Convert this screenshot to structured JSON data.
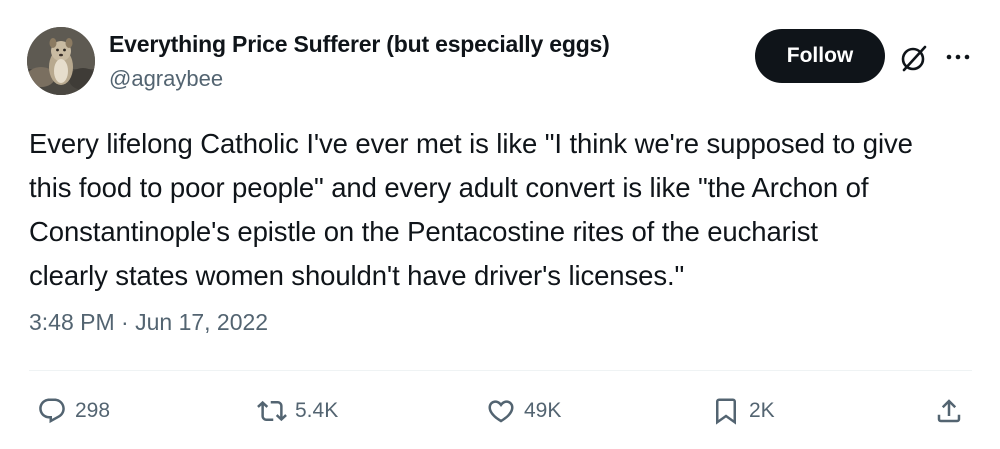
{
  "author": {
    "display_name": "Everything Price Sufferer (but especially eggs)",
    "handle": "@agraybee"
  },
  "actions": {
    "follow_label": "Follow"
  },
  "tweet": {
    "lines": [
      "Every lifelong Catholic I've ever met is like \"I think we're supposed to give",
      "this food to poor people\" and every adult convert is like \"the Archon of",
      "Constantinople's epistle on the Pentacostine rites of the eucharist",
      "clearly states women shouldn't have driver's licenses.\""
    ],
    "timestamp": "3:48 PM · Jun 17, 2022"
  },
  "metrics": {
    "replies": "298",
    "reposts": "5.4K",
    "likes": "49K",
    "bookmarks": "2K"
  },
  "icons": {
    "reply": "reply-icon",
    "repost": "repost-icon",
    "like": "heart-icon",
    "bookmark": "bookmark-icon",
    "share": "share-icon",
    "grok": "grok-icon",
    "more": "more-icon"
  },
  "colors": {
    "text": "#0f1419",
    "secondary": "#536471",
    "follow_bg": "#0f1419",
    "divider": "#eff3f4"
  }
}
